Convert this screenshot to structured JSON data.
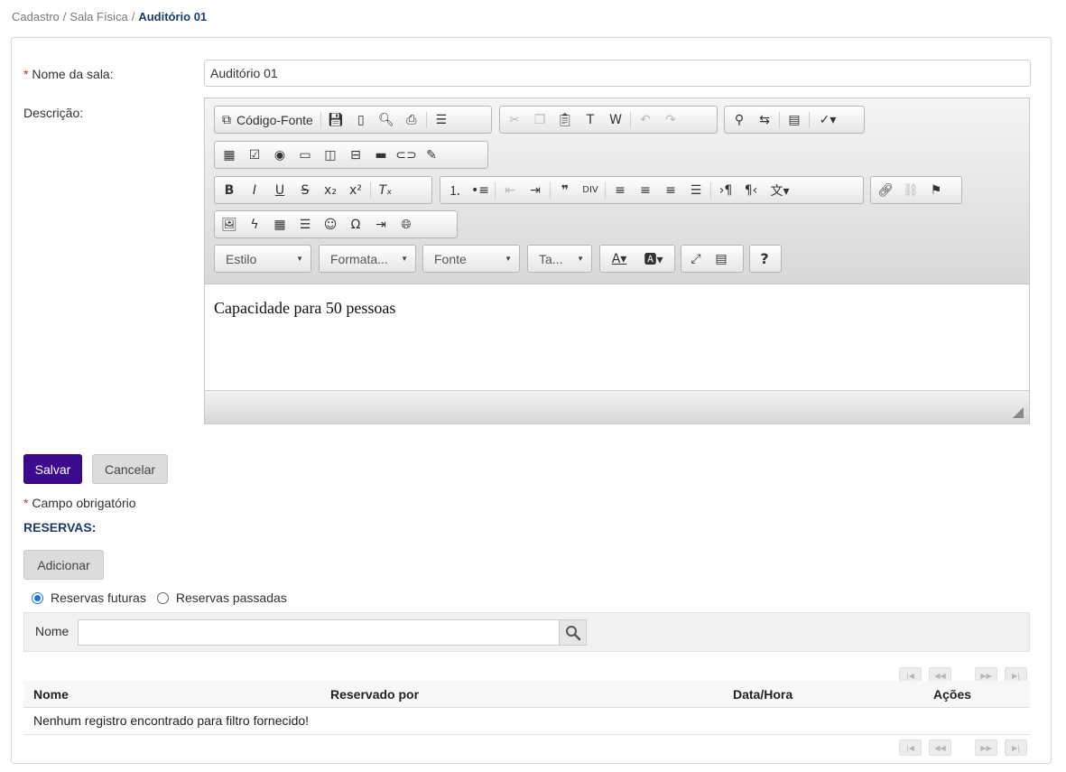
{
  "breadcrumb": {
    "item1": "Cadastro",
    "item2": "Sala Física",
    "current": "Auditório 01",
    "separator": "/"
  },
  "form": {
    "required_mark": "*",
    "name_label": "Nome da sala:",
    "name_value": "Auditório 01",
    "description_label": "Descrição:",
    "description_content": "Capacidade para 50 pessoas",
    "required_note": "Campo obrigatório"
  },
  "editor": {
    "source_label": "Código-Fonte",
    "combos": {
      "style": "Estilo",
      "format": "Formata...",
      "font": "Fonte",
      "size": "Ta..."
    }
  },
  "buttons": {
    "save": "Salvar",
    "cancel": "Cancelar",
    "add": "Adicionar"
  },
  "reservations": {
    "title": "RESERVAS:",
    "radio_future": "Reservas futuras",
    "radio_past": "Reservas passadas",
    "selected": "Reservas futuras",
    "filter_label": "Nome",
    "columns": [
      "Nome",
      "Reservado por",
      "Data/Hora",
      "Ações"
    ],
    "empty_message": "Nenhum registro encontrado para filtro fornecido!"
  },
  "colors": {
    "primary": "#3b0a8f",
    "title": "#1d3b6e",
    "required": "#c0392b"
  }
}
